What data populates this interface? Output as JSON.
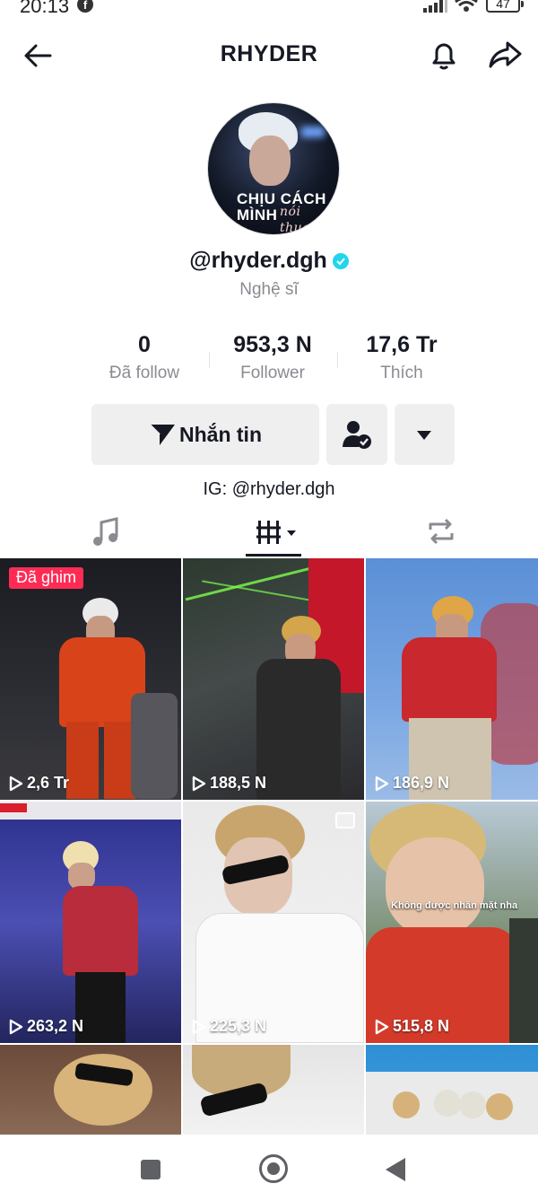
{
  "status_bar": {
    "time": "20:13",
    "battery": "47"
  },
  "header": {
    "title": "RHYDER"
  },
  "profile": {
    "avatar_text_line1": "CHỊU CÁCH",
    "avatar_text_line2": "MÌNH",
    "avatar_text_script": "nói thua",
    "username": "@rhyder.dgh",
    "category": "Nghệ sĩ",
    "bio": "IG: @rhyder.dgh"
  },
  "stats": [
    {
      "value": "0",
      "label": "Đã follow"
    },
    {
      "value": "953,3 N",
      "label": "Follower"
    },
    {
      "value": "17,6 Tr",
      "label": "Thích"
    }
  ],
  "actions": {
    "message_label": "Nhắn tin"
  },
  "videos": [
    {
      "views": "2,6 Tr",
      "pinned_label": "Đã ghim"
    },
    {
      "views": "188,5 N"
    },
    {
      "views": "186,9 N"
    },
    {
      "views": "263,2 N"
    },
    {
      "views": "225,3 N"
    },
    {
      "views": "515,8 N",
      "caption": "Không được nhăn mặt nha"
    },
    {
      "views": ""
    },
    {
      "views": ""
    },
    {
      "views": ""
    }
  ],
  "colors": {
    "accent": "#fe2c55",
    "verified": "#20d5ec",
    "text": "#161823",
    "muted": "#8a8b91"
  }
}
